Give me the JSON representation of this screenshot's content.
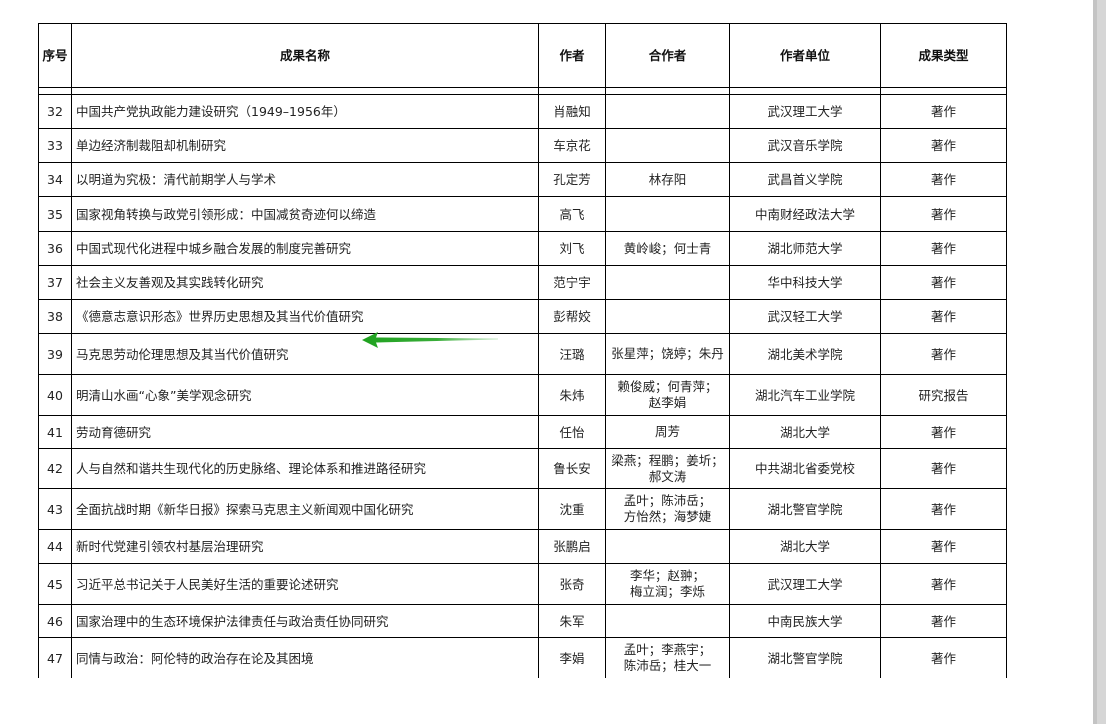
{
  "table": {
    "headers": {
      "index": "序号",
      "title": "成果名称",
      "author": "作者",
      "coauthors": "合作者",
      "unit": "作者单位",
      "type": "成果类型"
    },
    "rows": [
      {
        "index": "32",
        "title": "中国共产党执政能力建设研究（1949–1956年）",
        "author": "肖融知",
        "coauthors": [],
        "unit": "武汉理工大学",
        "type": "著作"
      },
      {
        "index": "33",
        "title": "单边经济制裁阻却机制研究",
        "author": "车京花",
        "coauthors": [],
        "unit": "武汉音乐学院",
        "type": "著作"
      },
      {
        "index": "34",
        "title": "以明道为究极：清代前期学人与学术",
        "author": "孔定芳",
        "coauthors": [
          "林存阳"
        ],
        "unit": "武昌首义学院",
        "type": "著作"
      },
      {
        "index": "35",
        "title": "国家视角转换与政党引领形成：中国减贫奇迹何以缔造",
        "author": "高飞",
        "coauthors": [],
        "unit": "中南财经政法大学",
        "type": "著作"
      },
      {
        "index": "36",
        "title": "中国式现代化进程中城乡融合发展的制度完善研究",
        "author": "刘飞",
        "coauthors": [
          "黄岭峻；何士青"
        ],
        "unit": "湖北师范大学",
        "type": "著作"
      },
      {
        "index": "37",
        "title": "社会主义友善观及其实践转化研究",
        "author": "范宁宇",
        "coauthors": [],
        "unit": "华中科技大学",
        "type": "著作"
      },
      {
        "index": "38",
        "title": "《德意志意识形态》世界历史思想及其当代价值研究",
        "author": "彭帮姣",
        "coauthors": [],
        "unit": "武汉轻工大学",
        "type": "著作"
      },
      {
        "index": "39",
        "title": "马克思劳动伦理思想及其当代价值研究",
        "author": "汪璐",
        "coauthors": [
          "张星萍；饶婷；朱丹"
        ],
        "unit": "湖北美术学院",
        "type": "著作"
      },
      {
        "index": "40",
        "title": "明清山水画“心象”美学观念研究",
        "author": "朱炜",
        "coauthors": [
          "赖俊威；何青萍；",
          "赵李娟"
        ],
        "unit": "湖北汽车工业学院",
        "type": "研究报告"
      },
      {
        "index": "41",
        "title": "劳动育德研究",
        "author": "任怡",
        "coauthors": [
          "周芳"
        ],
        "unit": "湖北大学",
        "type": "著作"
      },
      {
        "index": "42",
        "title": "人与自然和谐共生现代化的历史脉络、理论体系和推进路径研究",
        "author": "鲁长安",
        "coauthors": [
          "梁燕；程鹏；姜圻；",
          "郝文涛"
        ],
        "unit": "中共湖北省委党校",
        "type": "著作"
      },
      {
        "index": "43",
        "title": "全面抗战时期《新华日报》探索马克思主义新闻观中国化研究",
        "author": "沈重",
        "coauthors": [
          "孟叶；陈沛岳；",
          "方怡然；海梦婕"
        ],
        "unit": "湖北警官学院",
        "type": "著作"
      },
      {
        "index": "44",
        "title": "新时代党建引领农村基层治理研究",
        "author": "张鹏启",
        "coauthors": [],
        "unit": "湖北大学",
        "type": "著作"
      },
      {
        "index": "45",
        "title": "习近平总书记关于人民美好生活的重要论述研究",
        "author": "张奇",
        "coauthors": [
          "李华；赵翀；",
          "梅立润；李烁"
        ],
        "unit": "武汉理工大学",
        "type": "著作"
      },
      {
        "index": "46",
        "title": "国家治理中的生态环境保护法律责任与政治责任协同研究",
        "author": "朱军",
        "coauthors": [],
        "unit": "中南民族大学",
        "type": "著作"
      },
      {
        "index": "47",
        "title": "同情与政治：阿伦特的政治存在论及其困境",
        "author": "李娟",
        "coauthors": [
          "孟叶；李燕宇；",
          "陈沛岳；桂大一"
        ],
        "unit": "湖北警官学院",
        "type": "著作"
      }
    ]
  },
  "colors": {
    "arrow": "#2ea82e",
    "border": "#000000",
    "scrollbar": "#d6d6d6"
  },
  "icons": {
    "arrow": "left-pointing-arrow-icon"
  }
}
